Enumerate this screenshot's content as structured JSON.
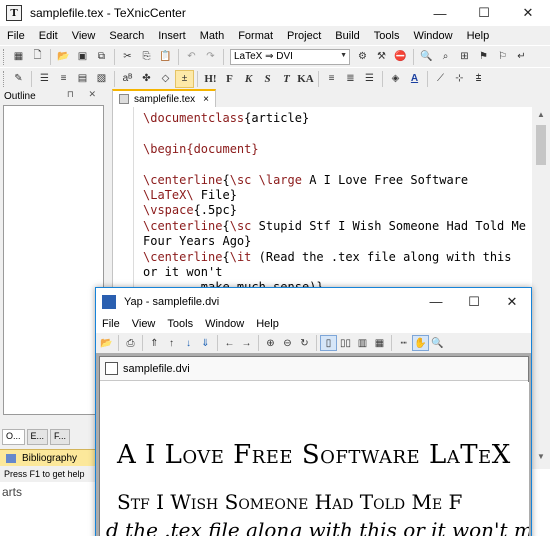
{
  "main": {
    "title": "samplefile.tex - TeXnicCenter",
    "app_icon": "T",
    "window_buttons": {
      "minimize": "—",
      "maximize": "☐",
      "close": "✕"
    },
    "menu": [
      "File",
      "Edit",
      "View",
      "Search",
      "Insert",
      "Math",
      "Format",
      "Project",
      "Build",
      "Tools",
      "Window",
      "Help"
    ],
    "toolbar": {
      "profile_combo": "LaTeX ⇒ DVI",
      "format_buttons": [
        "H!",
        "F",
        "K",
        "S",
        "T",
        "KA"
      ]
    }
  },
  "outline": {
    "header": "Outline",
    "header_buttons": "⊓ ✕",
    "tabs": [
      "O...",
      "E...",
      "F..."
    ],
    "bibliography_label": "Bibliography",
    "status": "Press F1 to get help"
  },
  "editor": {
    "tab_label": "samplefile.tex",
    "tab_close": "×"
  },
  "code": {
    "l1_cmd": "\\documentclass",
    "l1_arg": "{article}",
    "l3_cmd": "\\begin",
    "l3_arg": "{document}",
    "l5_cmd": "\\centerline",
    "l5_brace": "{",
    "l5_sc": "\\sc \\large",
    "l5_text": " A I Love Free Software",
    "l6_cmd": "\\LaTeX\\",
    "l6_text": " File}",
    "l7_cmd": "\\vspace",
    "l7_arg": "{.5pc}",
    "l8_cmd": "\\centerline",
    "l8_brace": "{",
    "l8_sc": "\\sc",
    "l8_text": " Stupid Stf I Wish Someone Had Told Me Four Years Ago}",
    "l9_cmd": "\\centerline",
    "l9_brace": "{",
    "l9_it": "\\it",
    "l9_text": " (Read the .tex file along with this or it won't",
    "l10_text": "        make much sense)}"
  },
  "below_text": "arts",
  "yap": {
    "title": "Yap - samplefile.dvi",
    "window_buttons": {
      "minimize": "—",
      "maximize": "☐",
      "close": "✕"
    },
    "menu": [
      "File",
      "View",
      "Tools",
      "Window",
      "Help"
    ],
    "doc_title": "samplefile.dvi",
    "dvi_line1": "A I Love Free Software LaTeX",
    "dvi_line2": "Stf I Wish Someone Had Told Me F",
    "dvi_line3": "d the .tex file along with this or it won't ma"
  }
}
